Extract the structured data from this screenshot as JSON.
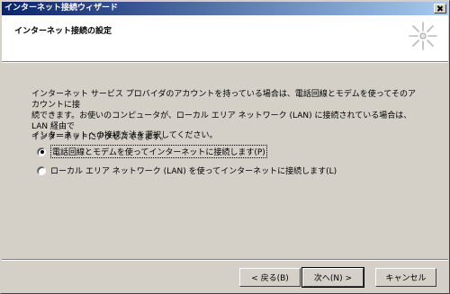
{
  "window": {
    "title": "インターネット接続ウィザード",
    "close_label": "×"
  },
  "header": {
    "title": "インターネット接続の設定",
    "icon": "wizard-sparkle-icon"
  },
  "content": {
    "intro": "インターネット サービス プロバイダのアカウントを持っている場合は、電話回線とモデムを使ってそのアカウントに接\n続できます。お使いのコンピュータが、ローカル エリア ネットワーク (LAN) に接続されている場合は、LAN 経由で\nインターネットにアクセスできます。",
    "prompt": "インターネットへの接続方法を選択してください。",
    "options": [
      {
        "label": "電話回線とモデムを使ってインターネットに接続します(P)",
        "checked": true
      },
      {
        "label": "ローカル エリア ネットワーク (LAN) を使ってインターネットに接続します(L)",
        "checked": false
      }
    ]
  },
  "footer": {
    "back_label": "< 戻る(B)",
    "next_label": "次へ(N) >",
    "cancel_label": "キャンセル"
  }
}
